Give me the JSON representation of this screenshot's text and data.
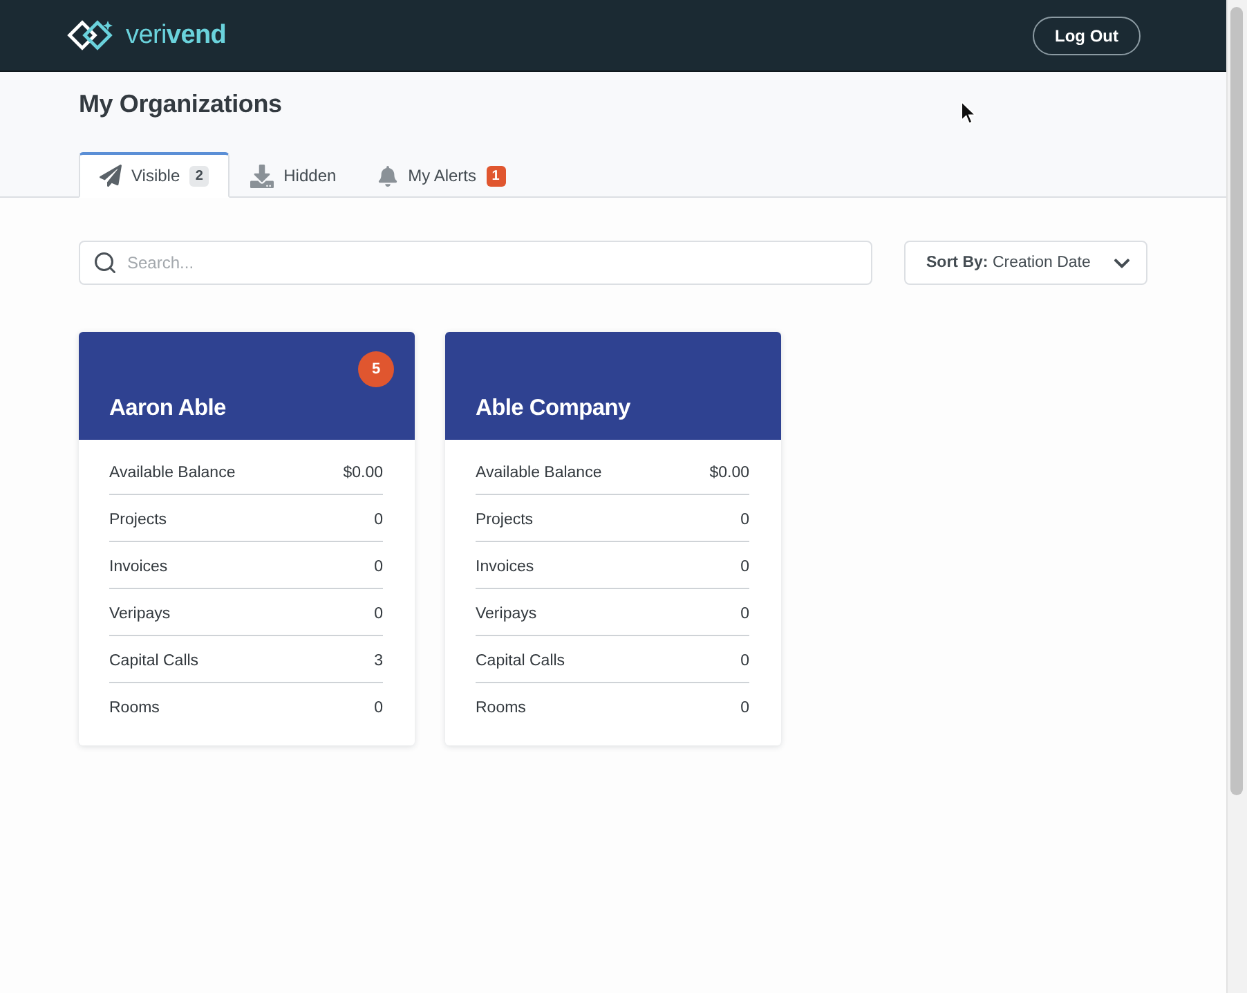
{
  "header": {
    "logo": "veri**vend**",
    "logout_button": "Log Out"
  },
  "page_title": "My Organizations",
  "tabs": [
    {
      "kind": "visible",
      "label": "Visible",
      "badge": {
        "text": "2",
        "kind": "neutral"
      },
      "selected": true
    },
    {
      "kind": "hidden",
      "label": "Hidden",
      "selected": false
    },
    {
      "kind": "alerts",
      "label": "My Alerts",
      "badge": {
        "text": "1",
        "kind": "alert"
      },
      "selected": false
    }
  ],
  "search": {
    "placeholder": "Search..."
  },
  "sort": {
    "label": "Sort By:",
    "value": "Creation Date"
  },
  "cards": [
    {
      "name": "Aaron Able",
      "alert_count": "5",
      "stats": [
        {
          "label": "Available Balance",
          "value": "$0.00"
        },
        {
          "label": "Projects",
          "value": "0"
        },
        {
          "label": "Invoices",
          "value": "0"
        },
        {
          "label": "Veripays",
          "value": "0"
        },
        {
          "label": "Capital Calls",
          "value": "3"
        },
        {
          "label": "Rooms",
          "value": "0"
        }
      ]
    },
    {
      "name": "Able Company",
      "stats": [
        {
          "label": "Available Balance",
          "value": "$0.00"
        },
        {
          "label": "Projects",
          "value": "0"
        },
        {
          "label": "Invoices",
          "value": "0"
        },
        {
          "label": "Veripays",
          "value": "0"
        },
        {
          "label": "Capital Calls",
          "value": "0"
        },
        {
          "label": "Rooms",
          "value": "0"
        }
      ]
    }
  ]
}
